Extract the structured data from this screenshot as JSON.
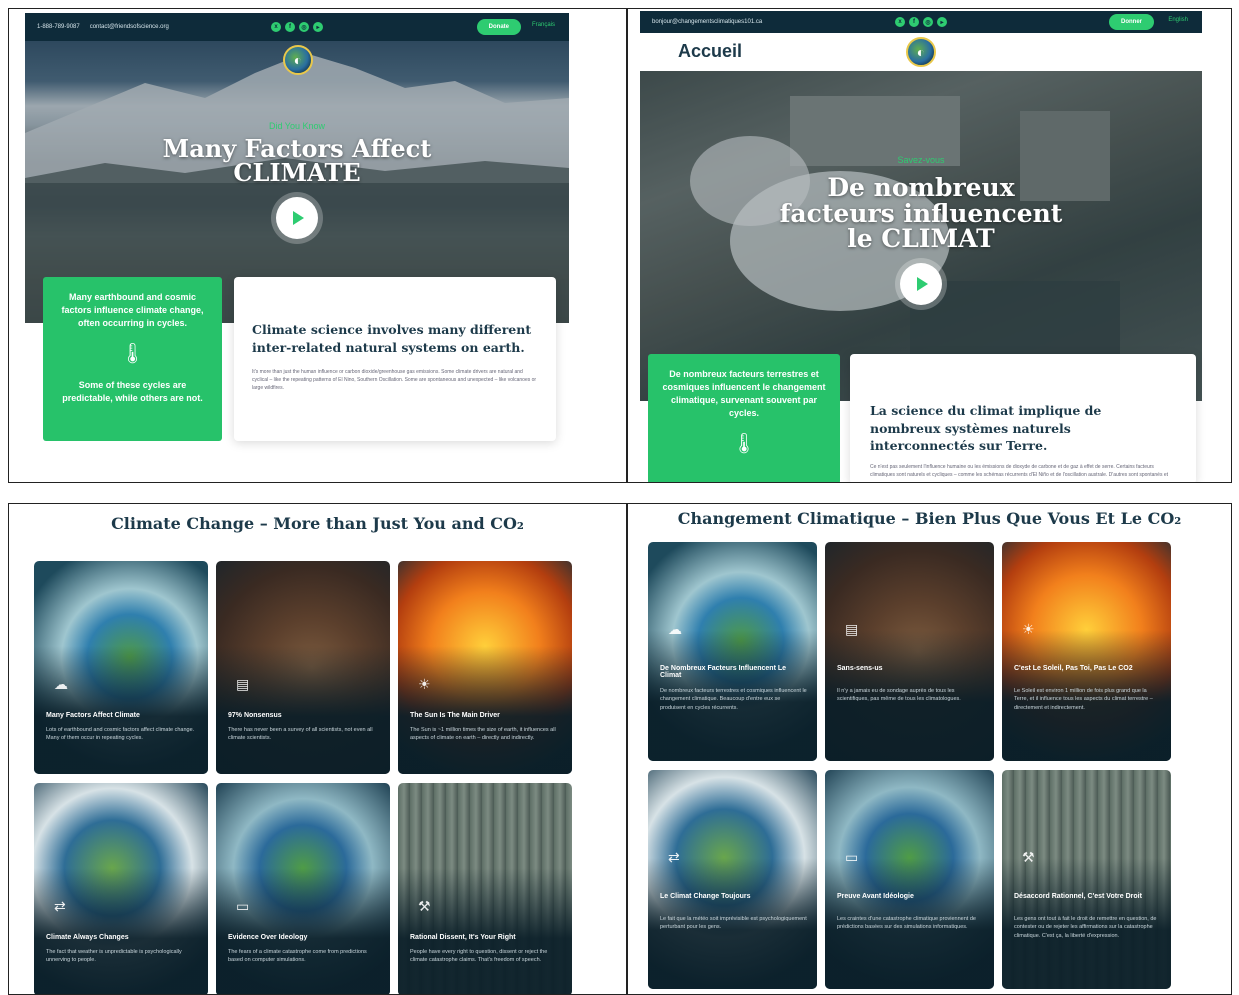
{
  "en_hero": {
    "phone": "1-888-789-9087",
    "email": "contact@friendsofscience.org",
    "donate": "Donate",
    "lang": "Français",
    "eyebrow": "Did You Know",
    "title_line1": "Many Factors Affect",
    "title_line2": "CLIMATE",
    "green_text": "Many earthbound and cosmic factors influence climate change, often occurring in cycles.",
    "green_text2": "Some of these cycles are predictable, while others are not.",
    "white_title": "Climate science involves many different inter-related natural systems on earth.",
    "white_body": "It's more than just the human influence or carbon dioxide/greenhouse gas emissions. Some climate drivers are natural and cyclical – like the repeating patterns of El Nino, Southern Oscillation. Some are spontaneous and unexpected – like volcanoes or large wildfires."
  },
  "fr_hero": {
    "email": "bonjour@changementsclimatiques101.ca",
    "donate": "Donner",
    "lang": "English",
    "page_label": "Accueil",
    "eyebrow": "Savez-vous",
    "title_line1": "De nombreux",
    "title_line2": "facteurs influencent",
    "title_line3": "le CLIMAT",
    "green_text": "De nombreux facteurs terrestres et cosmiques influencent le changement climatique, survenant souvent par cycles.",
    "white_title": "La science du climat implique de nombreux systèmes naturels interconnectés sur Terre.",
    "white_body": "Ce n'est pas seulement l'influence humaine ou les émissions de dioxyde de carbone et de gaz à effet de serre. Certains facteurs climatiques sont naturels et cycliques – comme les schémas récurrents d'El Niño et de l'oscillation australe. D'autres sont spontanés et"
  },
  "en_grid": {
    "title": "Climate Change – More than Just You and CO₂",
    "cards": [
      {
        "title": "Many Factors Affect Climate",
        "text": "Lots of earthbound and cosmic factors affect climate change. Many of them occur in repeating cycles.",
        "icon": "cloud-icon",
        "glyph": "☁"
      },
      {
        "title": "97% Nonsensus",
        "text": "There has never been a survey of all scientists, not even all climate scientists.",
        "icon": "chart-icon",
        "glyph": "▤"
      },
      {
        "title": "The Sun Is The Main Driver",
        "text": "The Sun is ~1 million times the size of earth, it influences all aspects of climate on earth – directly and indirectly.",
        "icon": "sun-icon",
        "glyph": "☀"
      },
      {
        "title": "Climate Always Changes",
        "text": "The fact that weather is unpredictable is psychologically unnerving to people.",
        "icon": "swap-icon",
        "glyph": "⇄"
      },
      {
        "title": "Evidence Over Ideology",
        "text": "The fears of a climate catastrophe come from predictions based on computer simulations.",
        "icon": "document-icon",
        "glyph": "▭"
      },
      {
        "title": "Rational Dissent, It's Your Right",
        "text": "People have every right to question, dissent or reject the climate catastrophe claims. That's freedom of speech.",
        "icon": "gavel-icon",
        "glyph": "⚒"
      }
    ]
  },
  "fr_grid": {
    "title": "Changement Climatique – Bien Plus Que Vous Et Le CO₂",
    "cards": [
      {
        "title": "De Nombreux Facteurs Influencent Le Climat",
        "text": "De nombreux facteurs terrestres et cosmiques influencent le changement climatique. Beaucoup d'entre eux se produisent en cycles récurrents.",
        "icon": "cloud-icon",
        "glyph": "☁"
      },
      {
        "title": "Sans-sens-us",
        "text": "Il n'y a jamais eu de sondage auprès de tous les scientifiques, pas même de tous les climatologues.",
        "icon": "chart-icon",
        "glyph": "▤"
      },
      {
        "title": "C'est Le Soleil, Pas Toi, Pas Le CO2",
        "text": "Le Soleil est environ 1 million de fois plus grand que la Terre, et il influence tous les aspects du climat terrestre – directement et indirectement.",
        "icon": "sun-icon",
        "glyph": "☀"
      },
      {
        "title": "Le Climat Change Toujours",
        "text": "Le fait que la météo soit imprévisible est psychologiquement perturbant pour les gens.",
        "icon": "swap-icon",
        "glyph": "⇄"
      },
      {
        "title": "Preuve Avant Idéologie",
        "text": "Les craintes d'une catastrophe climatique proviennent de prédictions basées sur des simulations informatiques.",
        "icon": "document-icon",
        "glyph": "▭"
      },
      {
        "title": "Désaccord Rationnel, C'est Votre Droit",
        "text": "Les gens ont tout à fait le droit de remettre en question, de contester ou de rejeter les affirmations sur la catastrophe climatique. C'est ça, la liberté d'expression.",
        "icon": "gavel-icon",
        "glyph": "⚒"
      }
    ]
  }
}
